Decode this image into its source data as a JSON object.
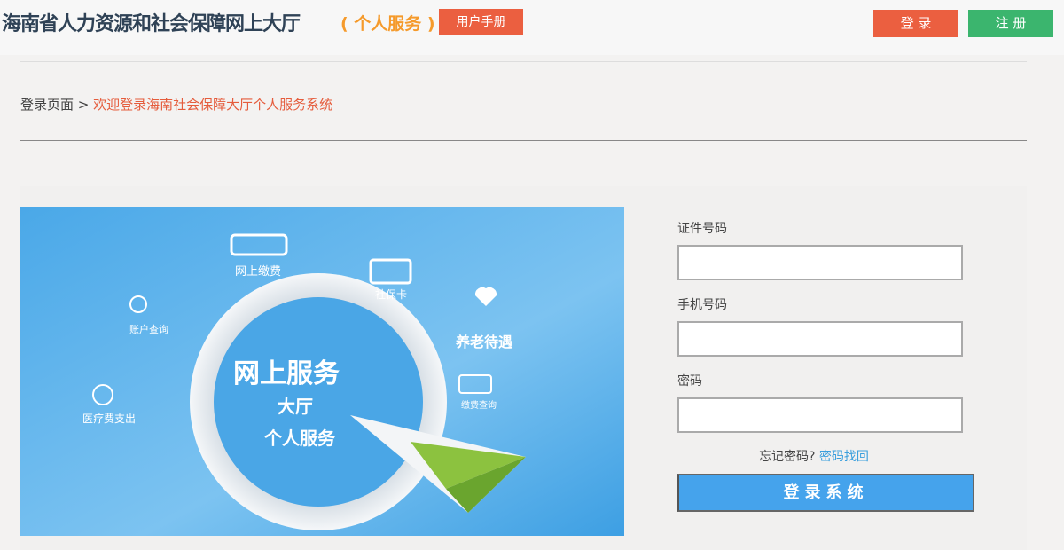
{
  "header": {
    "title": "海南省人力资源和社会保障网上大厅",
    "subtitle": "( 个人服务 )",
    "manual_label": "用户手册",
    "login_label": "登 录",
    "register_label": "注 册"
  },
  "breadcrumb": {
    "home": "登录页面",
    "separator": ">",
    "current": "欢迎登录海南社会保障大厅个人服务系统"
  },
  "banner": {
    "main": "网上服务",
    "line2": "大厅",
    "line3": "个人服务",
    "icons": [
      "网上缴费",
      "社保卡",
      "账户查询",
      "养老待遇",
      "医疗费支出",
      "缴费查询"
    ]
  },
  "form": {
    "id_label": "证件号码",
    "id_value": "",
    "phone_label": "手机号码",
    "phone_value": "",
    "password_label": "密码",
    "password_value": "",
    "forgot_text": "忘记密码?",
    "recover_link": "密码找回",
    "submit_label": "登录系统"
  },
  "colors": {
    "accent_red": "#eb5f40",
    "accent_green": "#3bb56e",
    "accent_blue": "#45a3ec"
  }
}
